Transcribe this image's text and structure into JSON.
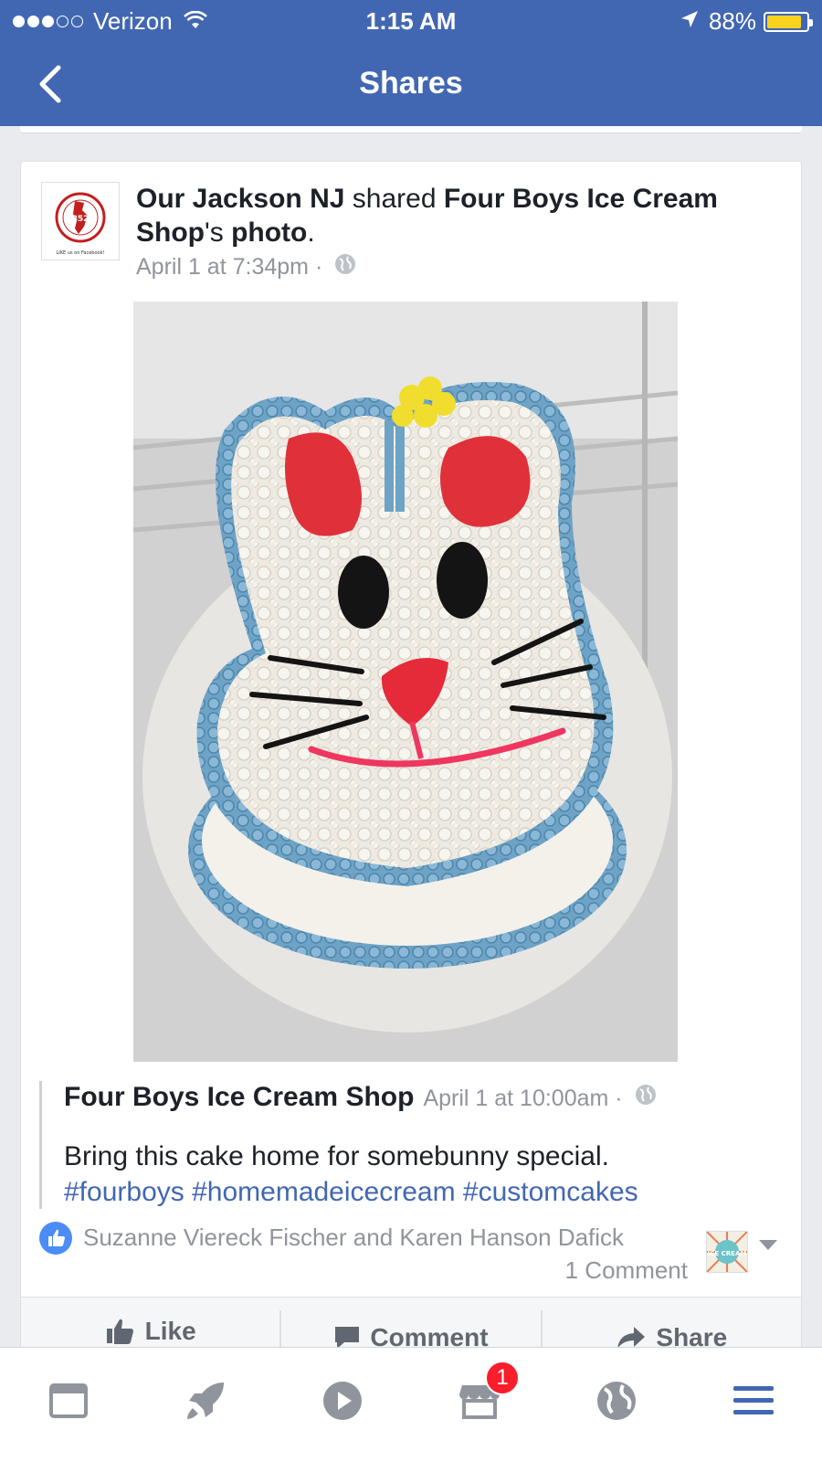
{
  "status_bar": {
    "signal_dots": [
      "full",
      "full",
      "full",
      "empty",
      "empty"
    ],
    "carrier": "Verizon",
    "time": "1:15 AM",
    "battery_text": "88%",
    "battery_level": 0.88
  },
  "nav": {
    "title": "Shares",
    "back_icon": "chevron-left-icon"
  },
  "post": {
    "sharer": "Our Jackson NJ",
    "action_text": " shared ",
    "source_page": "Four Boys Ice Cream Shop",
    "possessive": "'s ",
    "object": "photo",
    "period": ".",
    "timestamp": "April 1 at 7:34pm",
    "meta_separator": " · ",
    "avatar": {
      "name": "Our Jackson NJ",
      "zip": "08527",
      "footer": "LIKE us on Facebook!"
    },
    "quoted": {
      "page_name": "Four Boys Ice Cream Shop",
      "timestamp": "April 1 at 10:00am",
      "separator": " · ",
      "text": "Bring this cake home for somebunny special.",
      "hashtags": [
        "#fourboys",
        "#homemadeicecream",
        "#customcakes"
      ]
    },
    "reactions": {
      "likers": "Suzanne Viereck Fischer and Karen Hanson Dafick",
      "comments": "1 Comment",
      "thumbnail_text": "ICE CREAM"
    },
    "actions": [
      {
        "label": "Like",
        "icon": "thumbs-up-icon"
      },
      {
        "label": "Comment",
        "icon": "comment-icon"
      },
      {
        "label": "Share",
        "icon": "share-icon"
      }
    ]
  },
  "tabs": [
    {
      "name": "news-feed",
      "icon": "news-feed-icon"
    },
    {
      "name": "explore",
      "icon": "rocket-icon"
    },
    {
      "name": "video",
      "icon": "play-icon"
    },
    {
      "name": "marketplace",
      "icon": "marketplace-icon",
      "badge": "1"
    },
    {
      "name": "notifications",
      "icon": "globe-icon"
    },
    {
      "name": "menu",
      "icon": "hamburger-menu-icon"
    }
  ],
  "colors": {
    "brand": "#4267b2",
    "link": "#4267b2",
    "meta_text": "#90949c",
    "badge": "#fa1d2c",
    "battery": "#f7d21e"
  }
}
